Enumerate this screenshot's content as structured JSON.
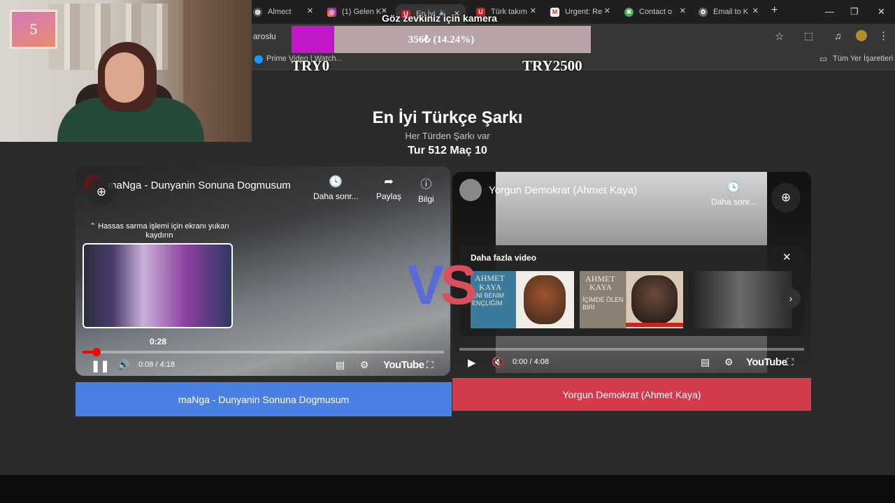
{
  "browser": {
    "tabs": [
      {
        "label": "Almect",
        "icon": "globe-icon"
      },
      {
        "label": "(1) Gelen K",
        "icon": "instagram-icon"
      },
      {
        "label": "En İyi",
        "icon": "u-logo-icon",
        "active": true
      },
      {
        "label": "Türk takım",
        "icon": "u-logo-icon"
      },
      {
        "label": "Urgent: Re",
        "icon": "gmail-icon"
      },
      {
        "label": "Contact o",
        "icon": "contact-icon"
      },
      {
        "label": "Email to K",
        "icon": "openai-icon"
      }
    ],
    "address_partial": "aroslu",
    "bookmark_item": "Prime Video | Watch...",
    "all_bookmarks": "Tüm Yer İşaretleri"
  },
  "overlay": {
    "counter": "5",
    "donation_title": "Göz zevkiniz için kamera",
    "donation_text": "356₺ (14.24%)",
    "donation_progress": 0.1424,
    "donation_min": "TRY0",
    "donation_max": "TRY2500"
  },
  "page": {
    "title": "En İyi Türkçe Şarkı",
    "subtitle": "Her Türden Şarkı var",
    "round": "Tur 512 Maç 10",
    "vs": "VS"
  },
  "left_video": {
    "title": "maNga - Dunyanin Sonuna Dogmusum",
    "actions": [
      "Daha sonr...",
      "Paylaş",
      "Bilgi"
    ],
    "hint": "⌃ Hassas sarma işlemi için ekranı yukarı kaydırın",
    "preview_time": "0:28",
    "time": "0:08 / 4:18",
    "progress": 0.031,
    "brand": "YouTube",
    "button_label": "maNga - Dunyanin Sonuna Dogmusum"
  },
  "right_video": {
    "title": "Yorgun Demokrat (Ahmet Kaya)",
    "action": "Daha sonr...",
    "more_videos": "Daha fazla video",
    "thumbs": [
      {
        "line1": "AHMET",
        "line2": "KAYA",
        "sub": "ENİ BENİM ENÇLİĞİM"
      },
      {
        "line1": "AHMET",
        "line2": "KAYA",
        "sub": "İÇİMDE ÖLEN BİRİ"
      },
      {
        "line1": "",
        "line2": "",
        "sub": ""
      }
    ],
    "time": "0:00 / 4:08",
    "progress": 0.0,
    "brand": "YouTube",
    "button_label": "Yorgun Demokrat (Ahmet Kaya)"
  },
  "colors": {
    "left_button": "#4a7fe3",
    "right_button": "#d33a4a",
    "donation_fill": "#c216c9",
    "vs_left": "#5b6bd6",
    "vs_right": "#d7505c"
  }
}
